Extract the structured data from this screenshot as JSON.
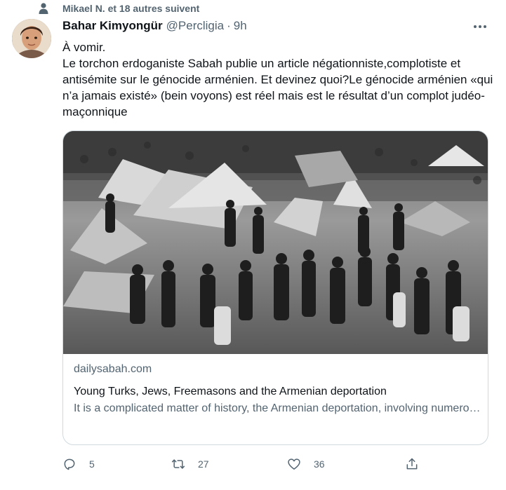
{
  "social_context": {
    "text": "Mikael N. et 18 autres suivent",
    "icon": "person-icon"
  },
  "author": {
    "name": "Bahar Kimyongür",
    "handle": "@Percligia",
    "separator": "·",
    "time": "9h"
  },
  "body": {
    "line1": "À vomir.",
    "line2": "Le torchon erdoganiste Sabah publie un article négationniste,complotiste et antisémite sur le génocide arménien. Et devinez quoi?Le génocide arménien «qui n’a jamais existé» (bein voyons) est réel mais est le résultat d’un complot judéo-maçonnique"
  },
  "card": {
    "domain": "dailysabah.com",
    "title": "Young Turks, Jews, Freemasons and the Armenian deportation",
    "description": "It is a complicated matter of history, the Armenian deportation, involving numerous actors from intertwined sects of Freemasons, You…"
  },
  "actions": {
    "reply_count": "5",
    "retweet_count": "27",
    "like_count": "36"
  },
  "colors": {
    "text": "#0f1419",
    "secondary": "#536471",
    "border": "#cfd9de"
  }
}
